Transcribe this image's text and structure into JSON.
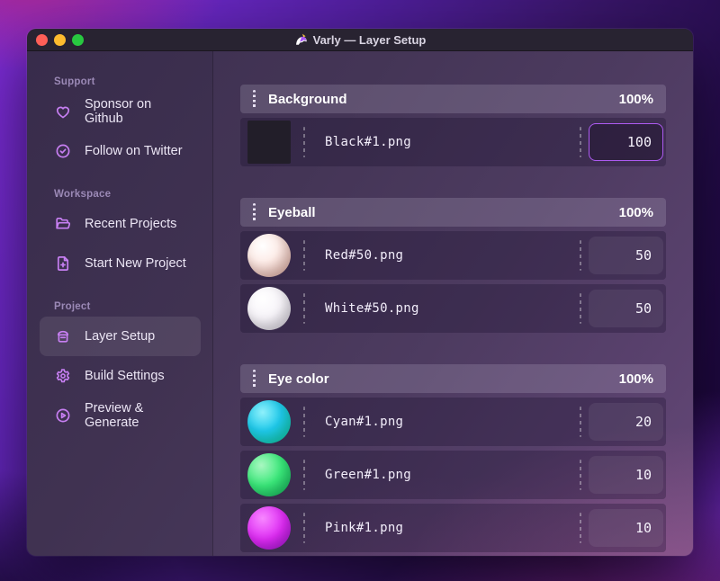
{
  "window": {
    "title": "Varly — Layer Setup",
    "app_icon": "unicorn-icon"
  },
  "sidebar": {
    "sections": [
      {
        "label": "Support",
        "items": [
          {
            "label": "Sponsor on Github",
            "icon": "heart-icon",
            "active": false
          },
          {
            "label": "Follow on Twitter",
            "icon": "badge-check-icon",
            "active": false
          }
        ]
      },
      {
        "label": "Workspace",
        "items": [
          {
            "label": "Recent Projects",
            "icon": "folder-icon",
            "active": false
          },
          {
            "label": "Start New Project",
            "icon": "file-plus-icon",
            "active": false
          }
        ]
      },
      {
        "label": "Project",
        "items": [
          {
            "label": "Layer Setup",
            "icon": "layers-icon",
            "active": true
          },
          {
            "label": "Build Settings",
            "icon": "gear-icon",
            "active": false
          },
          {
            "label": "Preview & Generate",
            "icon": "play-circle-icon",
            "active": false
          }
        ]
      }
    ]
  },
  "main": {
    "groups": [
      {
        "name": "Background",
        "weight": "100%",
        "layers": [
          {
            "file": "Black#1.png",
            "value": "100",
            "thumb": "black-square",
            "focused": true
          }
        ]
      },
      {
        "name": "Eyeball",
        "weight": "100%",
        "layers": [
          {
            "file": "Red#50.png",
            "value": "50",
            "thumb": "red-sphere",
            "focused": false
          },
          {
            "file": "White#50.png",
            "value": "50",
            "thumb": "white-sphere",
            "focused": false
          }
        ]
      },
      {
        "name": "Eye color",
        "weight": "100%",
        "layers": [
          {
            "file": "Cyan#1.png",
            "value": "20",
            "thumb": "cyan-sphere",
            "focused": false
          },
          {
            "file": "Green#1.png",
            "value": "10",
            "thumb": "green-sphere",
            "focused": false
          },
          {
            "file": "Pink#1.png",
            "value": "10",
            "thumb": "pink-sphere",
            "focused": false
          }
        ]
      }
    ]
  },
  "colors": {
    "accent": "#ae5bf2",
    "sidebar_icon": "#c77ff2",
    "traffic_close": "#ff5f57",
    "traffic_minimize": "#febc2e",
    "traffic_zoom": "#28c840"
  }
}
